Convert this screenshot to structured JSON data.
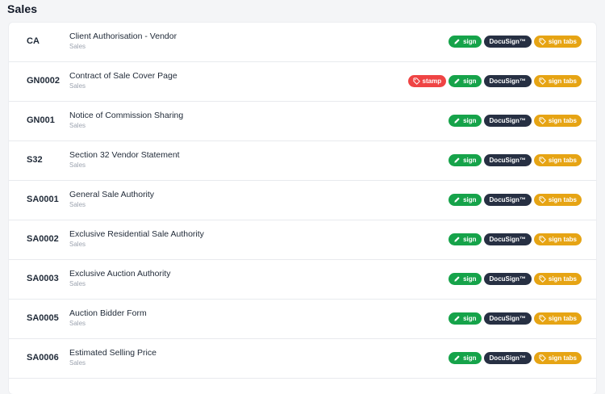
{
  "section": {
    "title": "Sales"
  },
  "badges": {
    "sign": "sign",
    "docusign": "DocuSign™",
    "sign_tabs": "sign tabs",
    "stamp": "stamp"
  },
  "documents": [
    {
      "code": "CA",
      "name": "Client Authorisation - Vendor",
      "category": "Sales",
      "stamp": false
    },
    {
      "code": "GN0002",
      "name": "Contract of Sale Cover Page",
      "category": "Sales",
      "stamp": true
    },
    {
      "code": "GN001",
      "name": "Notice of Commission Sharing",
      "category": "Sales",
      "stamp": false
    },
    {
      "code": "S32",
      "name": "Section 32 Vendor Statement",
      "category": "Sales",
      "stamp": false
    },
    {
      "code": "SA0001",
      "name": "General Sale Authority",
      "category": "Sales",
      "stamp": false
    },
    {
      "code": "SA0002",
      "name": "Exclusive Residential Sale Authority",
      "category": "Sales",
      "stamp": false
    },
    {
      "code": "SA0003",
      "name": "Exclusive Auction Authority",
      "category": "Sales",
      "stamp": false
    },
    {
      "code": "SA0005",
      "name": "Auction Bidder Form",
      "category": "Sales",
      "stamp": false
    },
    {
      "code": "SA0006",
      "name": "Estimated Selling Price",
      "category": "Sales",
      "stamp": false
    }
  ],
  "colors": {
    "sign": "#16a34a",
    "docusign": "#273043",
    "sign_tabs": "#e6a414",
    "stamp": "#ef4444"
  },
  "icons": {
    "sign": "pencil-icon",
    "sign_tabs": "tag-icon",
    "stamp": "tag-icon"
  }
}
